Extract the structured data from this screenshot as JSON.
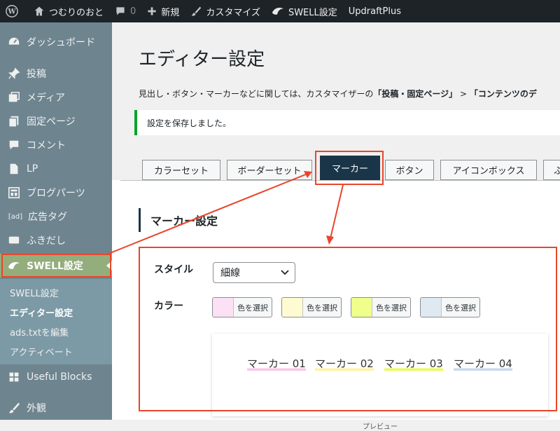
{
  "adminbar": {
    "site_name": "つむりのおと",
    "comments_count": "0",
    "new_label": "新規",
    "customize_label": "カスタマイズ",
    "swell_label": "SWELL設定",
    "updraft_label": "UpdraftPlus"
  },
  "sidebar": {
    "items": [
      {
        "label": "ダッシュボード",
        "icon": "dashboard-icon"
      },
      {
        "label": "投稿",
        "icon": "pin-icon"
      },
      {
        "label": "メディア",
        "icon": "media-icon"
      },
      {
        "label": "固定ページ",
        "icon": "page-icon"
      },
      {
        "label": "コメント",
        "icon": "comment-icon"
      },
      {
        "label": "LP",
        "icon": "document-icon"
      },
      {
        "label": "ブログパーツ",
        "icon": "blog-parts-icon"
      },
      {
        "label": "広告タグ",
        "icon": "ad-icon",
        "icon_text": "[ad]"
      },
      {
        "label": "ふきだし",
        "icon": "speech-bubble-icon"
      },
      {
        "label": "SWELL設定",
        "icon": "swell-icon"
      }
    ],
    "submenu": [
      {
        "label": "SWELL設定"
      },
      {
        "label": "エディター設定"
      },
      {
        "label": "ads.txtを編集"
      },
      {
        "label": "アクティベート"
      }
    ],
    "lower_items": [
      {
        "label": "Useful Blocks",
        "icon": "blocks-icon"
      },
      {
        "label": "外観",
        "icon": "brush-icon"
      }
    ]
  },
  "main": {
    "title": "エディター設定",
    "desc_prefix": "見出し・ボタン・マーカーなどに関しては、カスタマイザーの",
    "desc_bold1": "「投稿・固定ページ」",
    "desc_sep": " > ",
    "desc_bold2": "「コンテンツのデ",
    "notice": "設定を保存しました。",
    "tabs": [
      {
        "label": "カラーセット"
      },
      {
        "label": "ボーダーセット"
      },
      {
        "label": "マーカー"
      },
      {
        "label": "ボタン"
      },
      {
        "label": "アイコンボックス"
      },
      {
        "label": "ふ"
      }
    ],
    "section_title": "マーカー設定",
    "style_label": "スタイル",
    "style_value": "細線",
    "color_label": "カラー",
    "color_button_label": "色を選択",
    "swatches": [
      {
        "color": "#fbe1f3"
      },
      {
        "color": "#fefbd2"
      },
      {
        "color": "#f0fe8b"
      },
      {
        "color": "#e0e8f1"
      }
    ],
    "preview_markers": [
      {
        "text": "マーカー 01",
        "color": "#f7c6ea"
      },
      {
        "text": "マーカー 02",
        "color": "#fff3a0"
      },
      {
        "text": "マーカー 03",
        "color": "#e8fb5a"
      },
      {
        "text": "マーカー 04",
        "color": "#c8d9ec"
      }
    ],
    "preview_caption": "プレビュー"
  },
  "colors": {
    "callout": "#e8462b",
    "sidebar_bg": "#6e8590",
    "active_tab": "#1b3548",
    "current_menu": "#93ad7c"
  }
}
